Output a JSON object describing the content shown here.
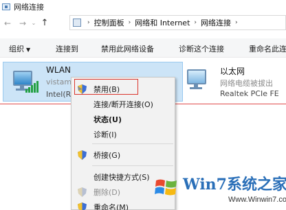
{
  "window": {
    "title": "网络连接"
  },
  "address": {
    "back": "←",
    "forward": "→",
    "dropdown": "⌄",
    "up": "↑",
    "crumbs": [
      "控制面板",
      "网络和 Internet",
      "网络连接"
    ],
    "separator": "›"
  },
  "toolbar": {
    "organize": "组织",
    "connect_to": "连接到",
    "disable_device": "禁用此网络设备",
    "diagnose": "诊断这个连接",
    "rename": "重命名此连"
  },
  "connections": [
    {
      "name": "WLAN",
      "status": "vistam",
      "adapter": "Intel(R"
    },
    {
      "name": "以太网",
      "status": "网络电缆被拔出",
      "adapter": "Realtek PCIe FE"
    }
  ],
  "context_menu": {
    "items": [
      {
        "label": "禁用(B)",
        "shield": true
      },
      {
        "label": "连接/断开连接(O)"
      },
      {
        "label": "状态(U)",
        "bold": true
      },
      {
        "label": "诊断(I)"
      },
      {
        "label": "桥接(G)",
        "shield": true
      },
      {
        "label": "创建快捷方式(S)"
      },
      {
        "label": "删除(D)",
        "shield": true,
        "disabled": true
      },
      {
        "label": "重命名(M)",
        "shield": true
      }
    ]
  },
  "watermark": {
    "brand": "Win7系统之家",
    "url": "Www.Winwin7.com"
  },
  "colors": {
    "selection": "#cce4f7",
    "highlight_border": "#d9342b",
    "signal_green": "#23a043",
    "brand_blue": "#2a6fb8"
  }
}
